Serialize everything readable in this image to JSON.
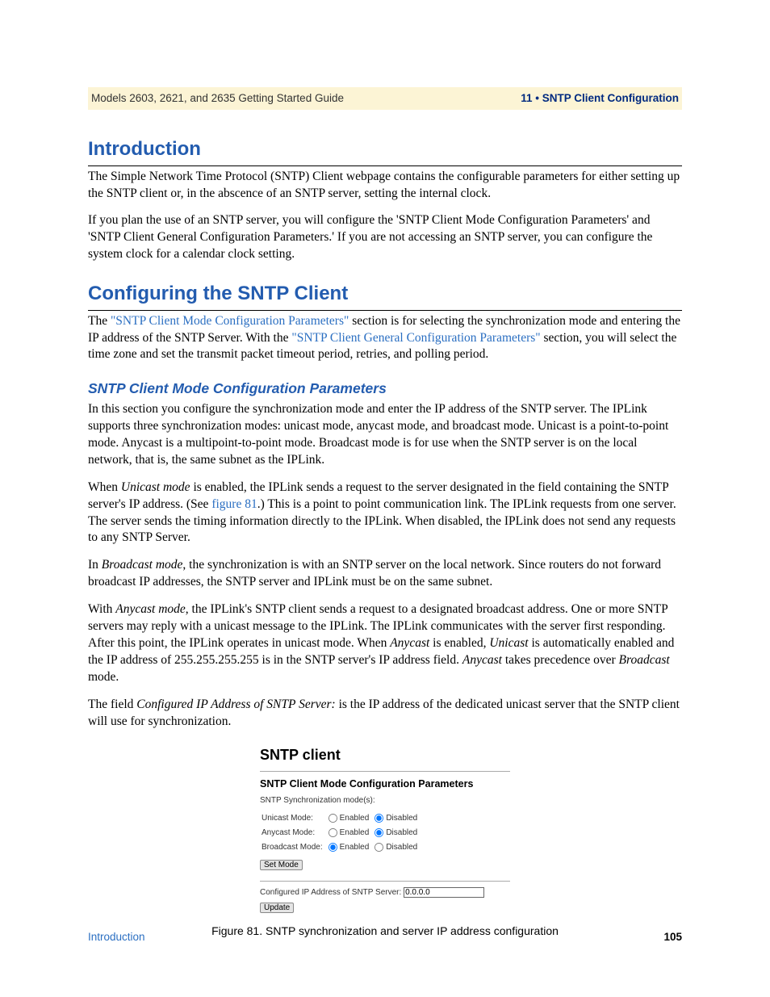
{
  "header": {
    "left": "Models 2603, 2621, and 2635 Getting Started Guide",
    "right": "11 • SNTP Client Configuration"
  },
  "h1_intro": "Introduction",
  "intro_p1": "The Simple Network Time Protocol (SNTP) Client webpage contains the configurable parameters for either setting up the SNTP client or, in the abscence of an SNTP server, setting the internal clock.",
  "intro_p2": "If you plan the use of an SNTP server, you will configure the 'SNTP Client Mode Configuration Parameters' and 'SNTP Client General Configuration Parameters.' If you are not accessing an SNTP server, you can configure the system clock for a calendar clock setting.",
  "h1_conf": "Configuring the SNTP Client",
  "conf_p1_a": "The ",
  "conf_p1_link1": "\"SNTP Client Mode Configuration Parameters\"",
  "conf_p1_b": " section is for selecting the synchronization mode and entering the IP address of the SNTP Server. With the ",
  "conf_p1_link2": "\"SNTP Client General Configuration Parameters\"",
  "conf_p1_c": " section, you will select the time zone and set the transmit packet timeout period, retries, and polling period.",
  "h2_mode": "SNTP Client Mode Configuration Parameters",
  "mode_p1": "In this section you configure the synchronization mode and enter the IP address of the SNTP server. The IPLink supports three synchronization modes: unicast mode, anycast mode, and broadcast mode. Unicast is a point-to-point mode. Anycast is a multipoint-to-point mode. Broadcast mode is for use when the SNTP server is on the local network, that is, the same subnet as the IPLink.",
  "mode_p2_a": "When ",
  "mode_p2_em1": "Unicast mode",
  "mode_p2_b": " is enabled, the IPLink sends a request to the server designated in the field containing the SNTP server's IP address. (See ",
  "mode_p2_link": "figure 81",
  "mode_p2_c": ".) This is a point to point communication link. The IPLink requests from one server. The server sends the timing information directly to the IPLink. When disabled, the IPLink does not send any requests to any SNTP Server.",
  "mode_p3_a": "In ",
  "mode_p3_em1": "Broadcast mode",
  "mode_p3_b": ", the synchronization is with an SNTP server on the local network. Since routers do not forward broadcast IP addresses, the SNTP server and IPLink must be on the same subnet.",
  "mode_p4_a": "With ",
  "mode_p4_em1": "Anycast mode",
  "mode_p4_b": ", the IPLink's SNTP client sends a request to a designated broadcast address. One or more SNTP servers may reply with a unicast message to the IPLink. The IPLink communicates with the server first responding. After this point, the IPLink operates in unicast mode. When ",
  "mode_p4_em2": "Anycast",
  "mode_p4_c": " is enabled, ",
  "mode_p4_em3": "Unicast",
  "mode_p4_d": " is automatically enabled and the IP address of 255.255.255.255 is in the SNTP server's IP address field. ",
  "mode_p4_em4": "Anycast",
  "mode_p4_e": " takes precedence over ",
  "mode_p4_em5": "Broadcast",
  "mode_p4_f": " mode.",
  "mode_p5_a": "The field ",
  "mode_p5_em1": "Configured IP Address of SNTP Server:",
  "mode_p5_b": " is the IP address of the dedicated unicast server that the SNTP client will use for synchronization.",
  "figure": {
    "title": "SNTP client",
    "section_heading": "SNTP Client Mode Configuration Parameters",
    "sync_label": "SNTP Synchronization mode(s):",
    "rows": [
      {
        "label": "Unicast Mode:",
        "enabled_label": "Enabled",
        "disabled_label": "Disabled",
        "selected": "disabled"
      },
      {
        "label": "Anycast Mode:",
        "enabled_label": "Enabled",
        "disabled_label": "Disabled",
        "selected": "disabled"
      },
      {
        "label": "Broadcast Mode:",
        "enabled_label": "Enabled",
        "disabled_label": "Disabled",
        "selected": "enabled"
      }
    ],
    "set_mode_btn": "Set Mode",
    "ip_label": "Configured IP Address of SNTP Server:",
    "ip_value": "0.0.0.0",
    "update_btn": "Update",
    "caption": "Figure 81. SNTP synchronization and server IP address configuration"
  },
  "footer": {
    "left": "Introduction",
    "right": "105"
  }
}
